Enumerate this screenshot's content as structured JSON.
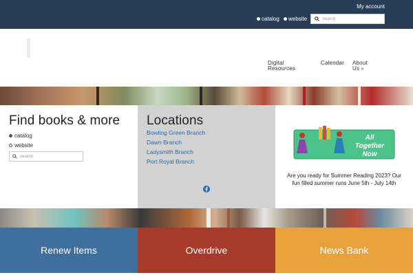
{
  "topbar": {
    "account_label": "My account",
    "scope_catalog": "catalog",
    "scope_website": "website",
    "search_placeholder": "Search"
  },
  "nav": {
    "digital_line1": "Digital",
    "digital_line2": "Resources",
    "calendar": "Calendar",
    "about_line1": "About",
    "about_line2": "Us"
  },
  "find": {
    "title": "Find books & more",
    "radio_catalog": "catalog",
    "radio_website": "website",
    "search_placeholder": "Search"
  },
  "locations": {
    "title": "Locations",
    "branches": [
      "Bowling Green Branch",
      "Dawn Branch",
      "Ladysmith Branch",
      "Port Royal Branch"
    ]
  },
  "summer": {
    "graphic_line1": "All",
    "graphic_line2": "Together",
    "graphic_line3": "Now",
    "text": "Are you ready for Summer Reading 2023? Our fun filled summer runs     June 5th - July 14th"
  },
  "tiles": {
    "renew": "Renew Items",
    "overdrive": "Overdrive",
    "newsbank": "News Bank"
  },
  "colors": {
    "topbar": "#283e56",
    "link": "#2a6bb1",
    "renew": "#3f6f9e",
    "overdrive": "#a83a2c",
    "newsbank": "#e8a23c",
    "locations_bg": "#d2d2d2",
    "banner_green": "#4cc38a"
  },
  "icons": {
    "search": "magnifier-icon",
    "facebook": "facebook-icon",
    "about_chevron": "chevron-down-double-icon"
  }
}
